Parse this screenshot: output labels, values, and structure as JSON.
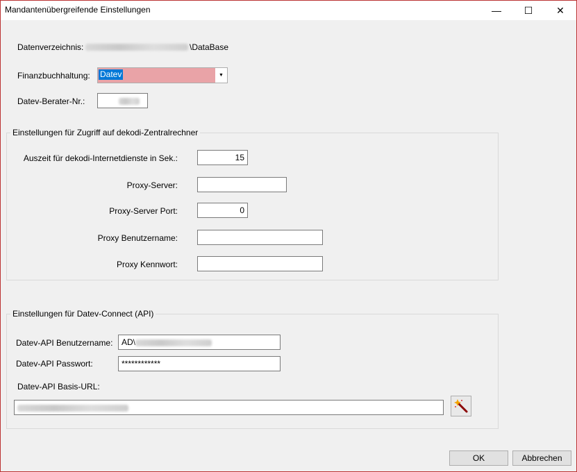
{
  "window": {
    "title": "Mandantenübergreifende Einstellungen",
    "minimize": "—",
    "maximize": "☐",
    "close": "✕"
  },
  "general": {
    "datenverzeichnis_label": "Datenverzeichnis:",
    "datenverzeichnis_suffix": "\\DataBase",
    "fibu_label": "Finanzbuchhaltung:",
    "fibu_value": "Datev",
    "berater_label": "Datev-Berater-Nr.:"
  },
  "zentral": {
    "title": "Einstellungen für Zugriff auf dekodi-Zentralrechner",
    "timeout_label": "Auszeit für dekodi-Internetdienste in Sek.:",
    "timeout_value": "15",
    "proxy_server_label": "Proxy-Server:",
    "proxy_server_value": "",
    "proxy_port_label": "Proxy-Server Port:",
    "proxy_port_value": "0",
    "proxy_user_label": "Proxy Benutzername:",
    "proxy_user_value": "",
    "proxy_pass_label": "Proxy Kennwort:",
    "proxy_pass_value": ""
  },
  "api": {
    "title": "Einstellungen für Datev-Connect (API)",
    "user_label": "Datev-API Benutzername:",
    "user_prefix": "AD\\",
    "pass_label": "Datev-API Passwort:",
    "pass_value": "************",
    "url_label": "Datev-API Basis-URL:",
    "wand_icon": "magic-wand-icon"
  },
  "buttons": {
    "ok": "OK",
    "cancel": "Abbrechen"
  }
}
